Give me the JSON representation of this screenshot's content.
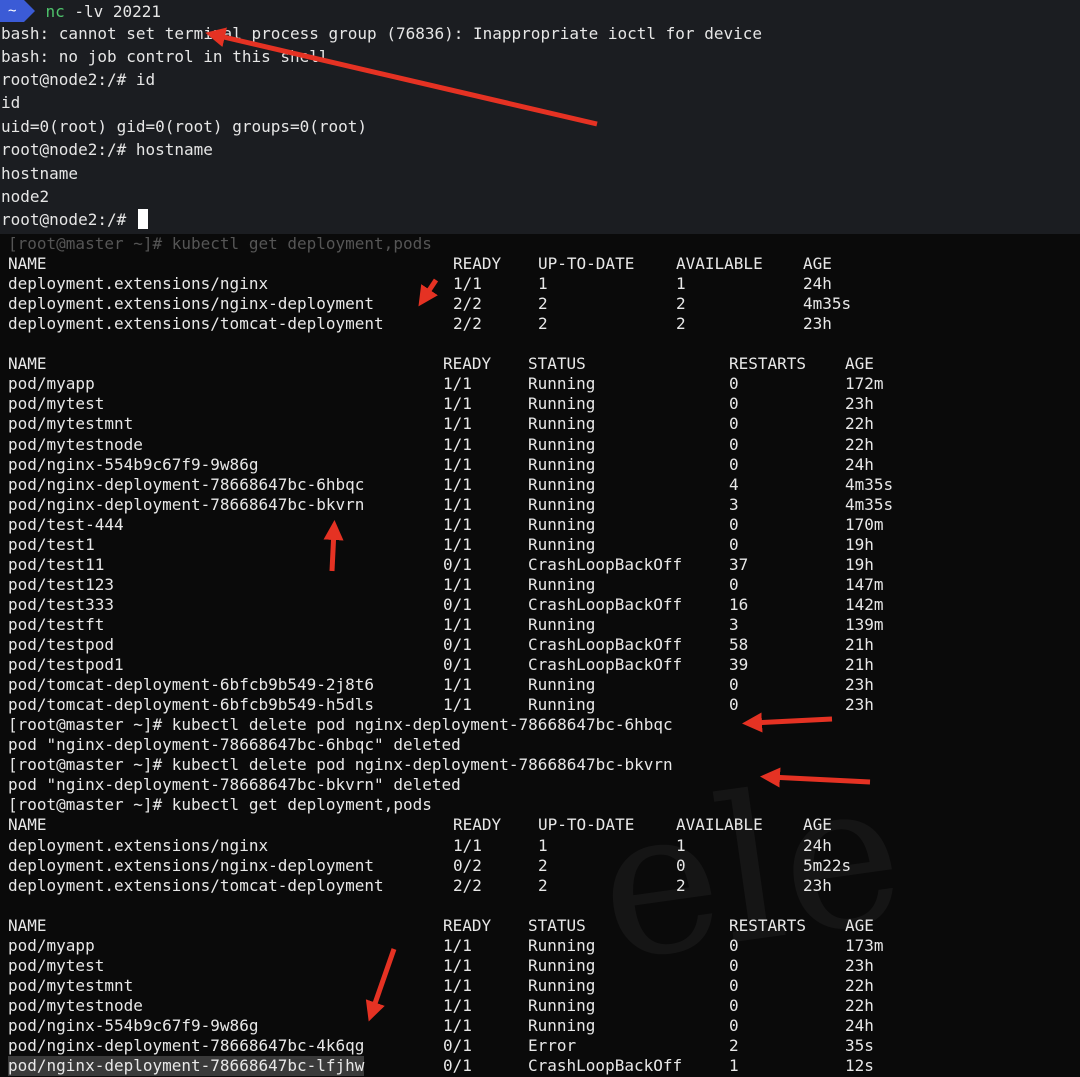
{
  "top_terminal": {
    "prompt_home": "~",
    "command_name": "nc",
    "command_args": " -lv 20221",
    "lines": [
      "bash: cannot set terminal process group (76836): Inappropriate ioctl for device",
      "bash: no job control in this shell",
      "root@node2:/# id",
      "id",
      "uid=0(root) gid=0(root) groups=0(root)",
      "root@node2:/# hostname",
      "hostname",
      "node2",
      "root@node2:/# "
    ]
  },
  "bottom_terminal": {
    "cmd1": "[root@master ~]# kubectl get deployment,pods",
    "deploy_headers": [
      "NAME",
      "READY",
      "UP-TO-DATE",
      "AVAILABLE",
      "AGE"
    ],
    "deploy1": [
      [
        "deployment.extensions/nginx",
        "1/1",
        "1",
        "1",
        "24h"
      ],
      [
        "deployment.extensions/nginx-deployment",
        "2/2",
        "2",
        "2",
        "4m35s"
      ],
      [
        "deployment.extensions/tomcat-deployment",
        "2/2",
        "2",
        "2",
        "23h"
      ]
    ],
    "pod_headers": [
      "NAME",
      "READY",
      "STATUS",
      "RESTARTS",
      "AGE"
    ],
    "pods1": [
      [
        "pod/myapp",
        "1/1",
        "Running",
        "0",
        "172m"
      ],
      [
        "pod/mytest",
        "1/1",
        "Running",
        "0",
        "23h"
      ],
      [
        "pod/mytestmnt",
        "1/1",
        "Running",
        "0",
        "22h"
      ],
      [
        "pod/mytestnode",
        "1/1",
        "Running",
        "0",
        "22h"
      ],
      [
        "pod/nginx-554b9c67f9-9w86g",
        "1/1",
        "Running",
        "0",
        "24h"
      ],
      [
        "pod/nginx-deployment-78668647bc-6hbqc",
        "1/1",
        "Running",
        "4",
        "4m35s"
      ],
      [
        "pod/nginx-deployment-78668647bc-bkvrn",
        "1/1",
        "Running",
        "3",
        "4m35s"
      ],
      [
        "pod/test-444",
        "1/1",
        "Running",
        "0",
        "170m"
      ],
      [
        "pod/test1",
        "1/1",
        "Running",
        "0",
        "19h"
      ],
      [
        "pod/test11",
        "0/1",
        "CrashLoopBackOff",
        "37",
        "19h"
      ],
      [
        "pod/test123",
        "1/1",
        "Running",
        "0",
        "147m"
      ],
      [
        "pod/test333",
        "0/1",
        "CrashLoopBackOff",
        "16",
        "142m"
      ],
      [
        "pod/testft",
        "1/1",
        "Running",
        "3",
        "139m"
      ],
      [
        "pod/testpod",
        "0/1",
        "CrashLoopBackOff",
        "58",
        "21h"
      ],
      [
        "pod/testpod1",
        "0/1",
        "CrashLoopBackOff",
        "39",
        "21h"
      ],
      [
        "pod/tomcat-deployment-6bfcb9b549-2j8t6",
        "1/1",
        "Running",
        "0",
        "23h"
      ],
      [
        "pod/tomcat-deployment-6bfcb9b549-h5dls",
        "1/1",
        "Running",
        "0",
        "23h"
      ]
    ],
    "mid_lines": [
      "[root@master ~]# kubectl delete pod nginx-deployment-78668647bc-6hbqc",
      "pod \"nginx-deployment-78668647bc-6hbqc\" deleted",
      "[root@master ~]# kubectl delete pod nginx-deployment-78668647bc-bkvrn",
      "pod \"nginx-deployment-78668647bc-bkvrn\" deleted",
      "[root@master ~]# kubectl get deployment,pods"
    ],
    "deploy2": [
      [
        "deployment.extensions/nginx",
        "1/1",
        "1",
        "1",
        "24h"
      ],
      [
        "deployment.extensions/nginx-deployment",
        "0/2",
        "2",
        "0",
        "5m22s"
      ],
      [
        "deployment.extensions/tomcat-deployment",
        "2/2",
        "2",
        "2",
        "23h"
      ]
    ],
    "pods2": [
      [
        "pod/myapp",
        "1/1",
        "Running",
        "0",
        "173m"
      ],
      [
        "pod/mytest",
        "1/1",
        "Running",
        "0",
        "23h"
      ],
      [
        "pod/mytestmnt",
        "1/1",
        "Running",
        "0",
        "22h"
      ],
      [
        "pod/mytestnode",
        "1/1",
        "Running",
        "0",
        "22h"
      ],
      [
        "pod/nginx-554b9c67f9-9w86g",
        "1/1",
        "Running",
        "0",
        "24h"
      ],
      [
        "pod/nginx-deployment-78668647bc-4k6qg",
        "0/1",
        "Error",
        "2",
        "35s"
      ],
      [
        "pod/nginx-deployment-78668647bc-lfjhw",
        "0/1",
        "CrashLoopBackOff",
        "1",
        "12s"
      ]
    ]
  },
  "colors": {
    "annotation_arrow": "#e53223",
    "prompt_badge": "#3b5bd6",
    "prompt_green": "#4ec26b"
  }
}
